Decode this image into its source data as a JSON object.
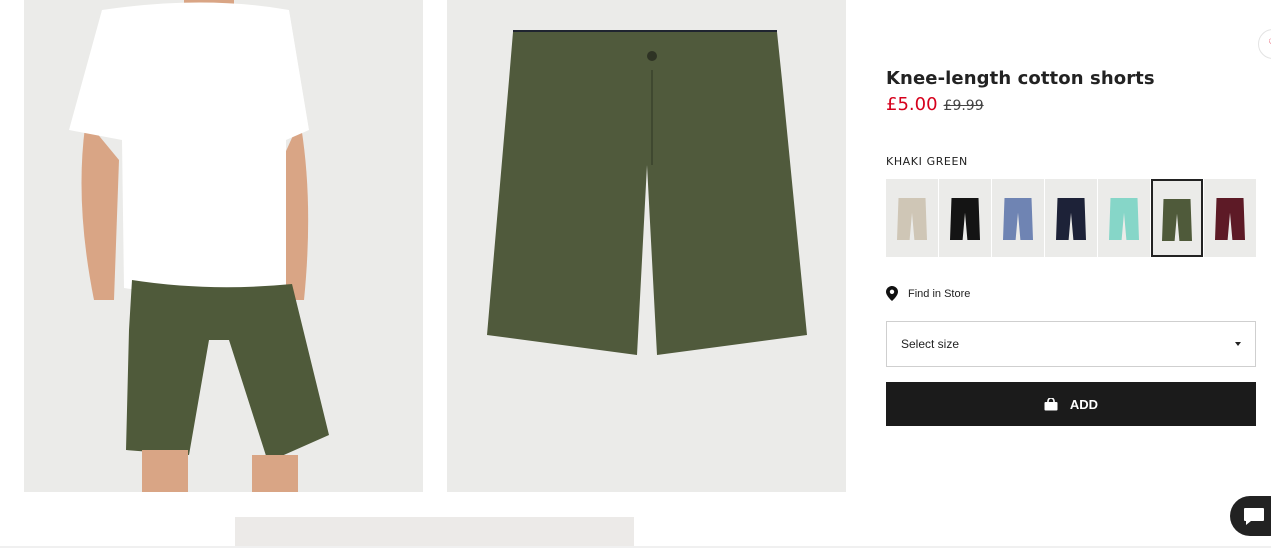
{
  "product": {
    "title": "Knee-length cotton shorts",
    "price_sale": "£5.00",
    "price_original": "£9.99",
    "selected_color": "KHAKI GREEN"
  },
  "swatches": [
    {
      "name": "beige",
      "color": "#cfc6b6",
      "selected": false
    },
    {
      "name": "black",
      "color": "#141414",
      "selected": false
    },
    {
      "name": "blue",
      "color": "#6f84b3",
      "selected": false
    },
    {
      "name": "dark blue",
      "color": "#1d2238",
      "selected": false
    },
    {
      "name": "mint",
      "color": "#86d6c8",
      "selected": false
    },
    {
      "name": "khaki green",
      "color": "#4f5a3a",
      "selected": true
    },
    {
      "name": "burgundy",
      "color": "#5d1a26",
      "selected": false
    }
  ],
  "find_in_store": "Find in Store",
  "size_select": {
    "label": "Select size"
  },
  "add_button": {
    "label": "ADD"
  },
  "colors": {
    "accent_red": "#d6001c",
    "button_dark": "#1b1b1b",
    "product_khaki": "#4f5a3a",
    "image_bg": "#ebebe9"
  }
}
